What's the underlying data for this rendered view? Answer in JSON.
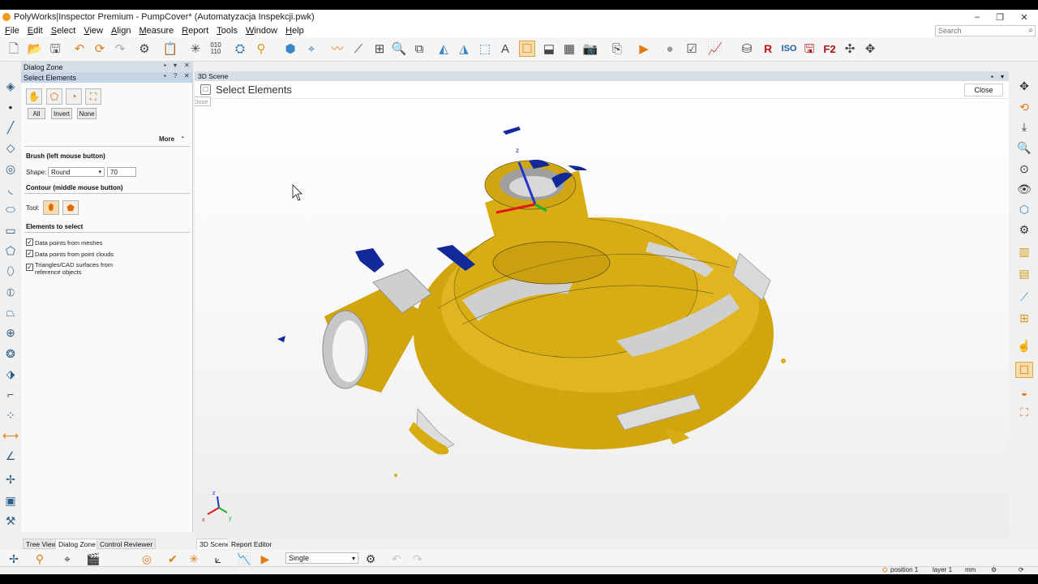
{
  "window": {
    "title": "PolyWorks|Inspector Premium - PumpCover* (Automatyzacja Inspekcji.pwk)",
    "controls": [
      "–",
      "❐",
      "✕"
    ]
  },
  "menu": {
    "items": [
      "File",
      "Edit",
      "Select",
      "View",
      "Align",
      "Measure",
      "Report",
      "Tools",
      "Window",
      "Help"
    ],
    "search_placeholder": "Search"
  },
  "toolbar": {
    "r_label": "R",
    "iso_label": "ISO",
    "f2_label": "F2",
    "icons": [
      "new-file-icon",
      "open-folder-icon",
      "save-icon",
      "undo-icon",
      "redo-icon",
      "settings-icon",
      "clipboard-icon",
      "align-icon",
      "binary-icon",
      "pump-icon",
      "alignment-icon",
      "cube-icon",
      "scan-icon",
      "curve-icon",
      "probe-icon",
      "layout-icon",
      "zoom-icon",
      "table-icon",
      "measure-icon",
      "report-icon",
      "camera-icon",
      "play-icon",
      "record-icon",
      "chart-icon",
      "database-icon"
    ]
  },
  "dialog_zone": {
    "title": "Dialog Zone",
    "select_panel_title": "Select Elements",
    "ctl_pin": "▪",
    "ctl_help": "?",
    "ctl_close": "✕",
    "ctl_menu": "▾",
    "buttons": {
      "all": "All",
      "invert": "Invert",
      "none": "None"
    },
    "more_label": "More",
    "more_chevron": "⌃",
    "brush_title": "Brush (left mouse button)",
    "shape_label": "Shape:",
    "shape_value": "Round",
    "shape_size": "70",
    "contour_title": "Contour (middle mouse button)",
    "tool_label": "Tool:",
    "elements_title": "Elements to select",
    "elements": [
      {
        "label": "Data points from meshes",
        "checked": true
      },
      {
        "label": "Data points from point clouds",
        "checked": true
      },
      {
        "label": "Triangles/CAD surfaces from reference objects",
        "checked": true
      }
    ],
    "bottom_tabs": [
      "Tree View",
      "Dialog Zone",
      "Control Reviewer"
    ]
  },
  "scene": {
    "panel_title": "3D Scene",
    "title": "Select Elements",
    "close_label": "Close",
    "close_tooltip": "Close",
    "axis_z": "z",
    "axis_x": "x",
    "axis_y": "y",
    "bottom_tabs": [
      "3D Scene",
      "Report Editor"
    ],
    "colors": {
      "part_yellow": "#d4a70f",
      "part_gray": "#c9c9c9",
      "points_blue": "#13299a",
      "axis_red": "#e01818",
      "axis_green": "#16b32c",
      "axis_blue": "#1f36c8"
    }
  },
  "bottom_toolbar": {
    "mode_value": "Single",
    "mode_arrow": "▾"
  },
  "status": {
    "position": "position 1",
    "layer": "layer 1",
    "units": "mm"
  }
}
